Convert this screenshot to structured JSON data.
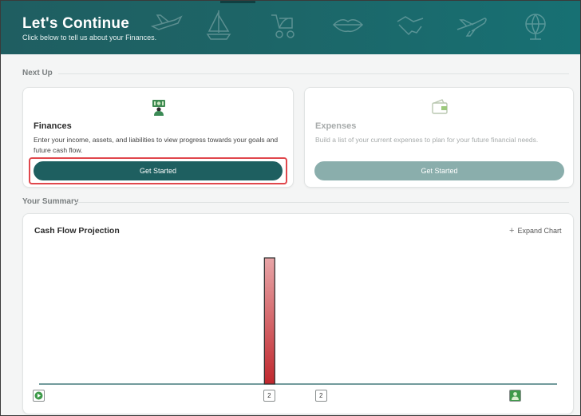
{
  "header": {
    "title": "Let's Continue",
    "subtitle": "Click below to tell us about your Finances."
  },
  "next_up": {
    "label": "Next Up",
    "cards": [
      {
        "title": "Finances",
        "description": "Enter your income, assets, and liabilities to view progress towards your goals and future cash flow.",
        "button_label": "Get Started",
        "icon": "finances-icon",
        "enabled": true
      },
      {
        "title": "Expenses",
        "description": "Build a list of your current expenses to plan for your future financial needs.",
        "button_label": "Get Started",
        "icon": "wallet-icon",
        "enabled": false
      }
    ]
  },
  "summary": {
    "label": "Your Summary",
    "chart_title": "Cash Flow Projection",
    "expand_label": "Expand Chart"
  },
  "chart_data": {
    "type": "bar",
    "title": "Cash Flow Projection",
    "xlabel": "",
    "ylabel": "",
    "bars": [
      {
        "position": 0.445,
        "value": 1.0
      }
    ],
    "markers": [
      {
        "name": "start-marker",
        "icon": "play-icon",
        "label": "",
        "position": 0.0
      },
      {
        "name": "marker-2a",
        "icon": "",
        "label": "2",
        "position": 0.445
      },
      {
        "name": "marker-2b",
        "icon": "",
        "label": "2",
        "position": 0.545
      },
      {
        "name": "person-marker",
        "icon": "person-icon",
        "label": "",
        "position": 0.92
      }
    ],
    "colors": {
      "bar": "#c0282e",
      "baseline": "#1e5f60",
      "accent": "#1e5f60"
    }
  }
}
